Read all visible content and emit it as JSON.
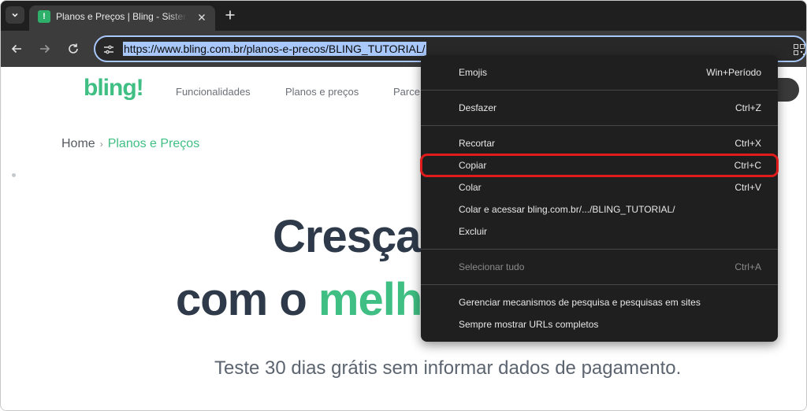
{
  "browser": {
    "tab": {
      "title": "Planos e Preços | Bling - Sistema de Gestão",
      "favicon_letter": "!"
    },
    "omnibox": {
      "url": "https://www.bling.com.br/planos-e-precos/BLING_TUTORIAL/"
    }
  },
  "site": {
    "logo": "bling!",
    "nav": [
      "Funcionalidades",
      "Planos e preços",
      "Parce"
    ]
  },
  "page": {
    "breadcrumb": {
      "home": "Home",
      "separator": "›",
      "current": "Planos e Preços"
    },
    "hero_line1": "Cresça",
    "hero_line2_prefix": "com o ",
    "hero_line2_accent": "melho",
    "subheading": "Teste 30 dias grátis sem informar dados de pagamento."
  },
  "context_menu": {
    "items": [
      {
        "label": "Emojis",
        "shortcut": "Win+Período"
      },
      {
        "label": "Desfazer",
        "shortcut": "Ctrl+Z"
      },
      {
        "label": "Recortar",
        "shortcut": "Ctrl+X"
      },
      {
        "label": "Copiar",
        "shortcut": "Ctrl+C",
        "highlighted": true
      },
      {
        "label": "Colar",
        "shortcut": "Ctrl+V"
      },
      {
        "label": "Colar e acessar bling.com.br/.../BLING_TUTORIAL/",
        "shortcut": ""
      },
      {
        "label": "Excluir",
        "shortcut": ""
      },
      {
        "label": "Selecionar tudo",
        "shortcut": "Ctrl+A",
        "disabled": true
      },
      {
        "label": "Gerenciar mecanismos de pesquisa e pesquisas em sites",
        "shortcut": ""
      },
      {
        "label": "Sempre mostrar URLs completos",
        "shortcut": ""
      }
    ]
  },
  "colors": {
    "brand_green": "#3fbf83",
    "highlight_outline": "#e01b1b",
    "url_selection": "#a8c7fa"
  }
}
